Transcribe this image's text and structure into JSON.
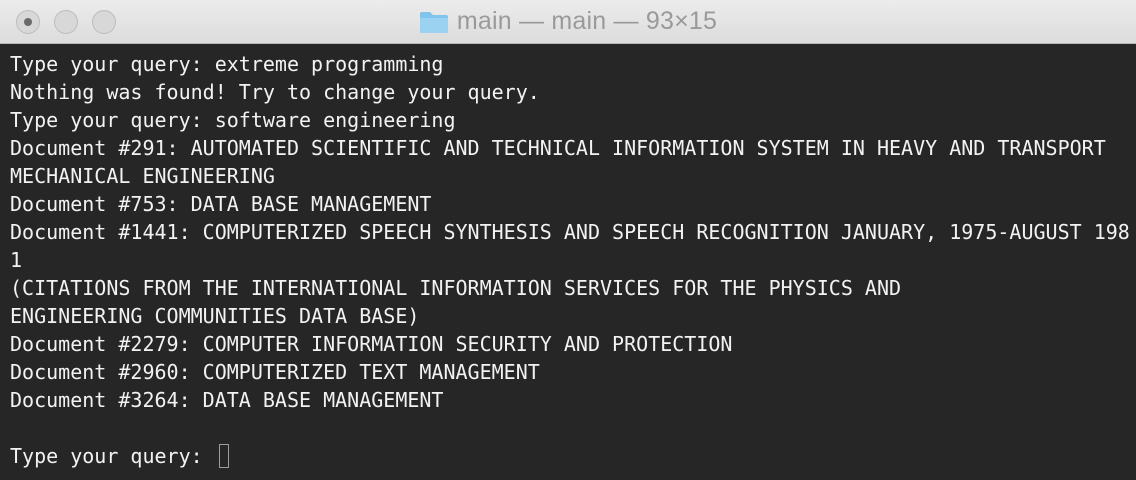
{
  "window": {
    "title": "main — main — 93×15",
    "title_icon": "folder-icon",
    "accent_color": "#7fc4ec"
  },
  "terminal": {
    "lines": [
      "Type your query: extreme programming",
      "Nothing was found! Try to change your query.",
      "Type your query: software engineering",
      "Document #291: AUTOMATED SCIENTIFIC AND TECHNICAL INFORMATION SYSTEM IN HEAVY AND TRANSPORT",
      "MECHANICAL ENGINEERING",
      "Document #753: DATA BASE MANAGEMENT",
      "Document #1441: COMPUTERIZED SPEECH SYNTHESIS AND SPEECH RECOGNITION JANUARY, 1975-AUGUST 198",
      "1",
      "(CITATIONS FROM THE INTERNATIONAL INFORMATION SERVICES FOR THE PHYSICS AND",
      "ENGINEERING COMMUNITIES DATA BASE)",
      "Document #2279: COMPUTER INFORMATION SECURITY AND PROTECTION",
      "Document #2960: COMPUTERIZED TEXT MANAGEMENT",
      "Document #3264: DATA BASE MANAGEMENT",
      "",
      "Type your query: "
    ]
  }
}
